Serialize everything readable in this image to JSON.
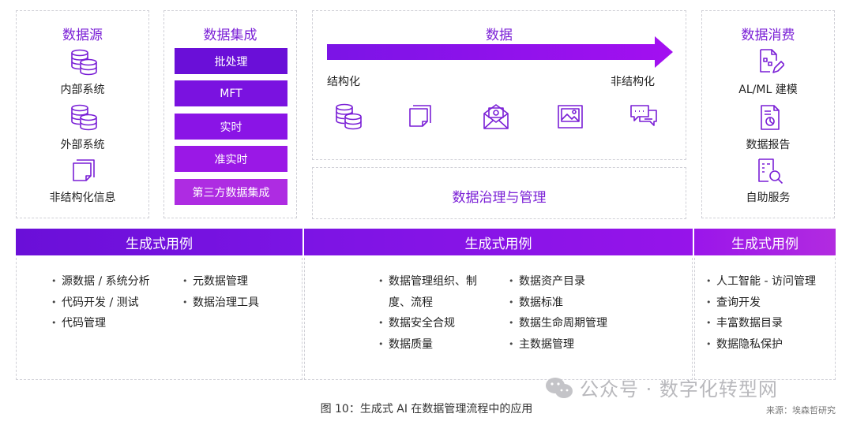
{
  "colors": {
    "purple": "#7a1fd6",
    "violet": "#8f10e8",
    "magenta": "#b12fe0",
    "band_left": "#6a0fd8",
    "band_right": "#b22be0"
  },
  "source_panel": {
    "title": "数据源",
    "items": [
      {
        "label": "内部系统",
        "icon": "database-icon"
      },
      {
        "label": "外部系统",
        "icon": "database-icon"
      },
      {
        "label": "非结构化信息",
        "icon": "documents-icon"
      }
    ]
  },
  "integration_panel": {
    "title": "数据集成",
    "bars": [
      "批处理",
      "MFT",
      "实时",
      "准实时",
      "第三方数据集成"
    ]
  },
  "data_panel": {
    "title": "数据",
    "left_label": "结构化",
    "right_label": "非结构化",
    "icons": [
      "database-icon",
      "documents-icon",
      "email-icon",
      "image-icon",
      "chat-icon"
    ]
  },
  "governance": {
    "label": "数据治理与管理"
  },
  "consumption_panel": {
    "title": "数据消费",
    "items": [
      {
        "label": "AL/ML 建模",
        "icon": "model-edit-icon"
      },
      {
        "label": "数据报告",
        "icon": "report-icon"
      },
      {
        "label": "自助服务",
        "icon": "self-service-icon"
      }
    ]
  },
  "bands": [
    "生成式用例",
    "生成式用例",
    "生成式用例"
  ],
  "usecases": {
    "left_col1": [
      "源数据 / 系统分析",
      "代码开发 / 测试",
      "代码管理"
    ],
    "left_col2": [
      "元数据管理",
      "数据治理工具"
    ],
    "mid_col1": [
      "数据管理组织、制",
      "度、流程",
      "数据安全合规",
      "数据质量"
    ],
    "mid_col2": [
      "数据资产目录",
      "数据标准",
      "数据生命周期管理",
      "主数据管理"
    ],
    "right_col": [
      "人工智能 - 访问管理",
      "查询开发",
      "丰富数据目录",
      "数据隐私保护"
    ]
  },
  "caption": "图 10：生成式 AI 在数据管理流程中的应用",
  "source": "来源：埃森哲研究",
  "watermark": "公众号 · 数字化转型网"
}
